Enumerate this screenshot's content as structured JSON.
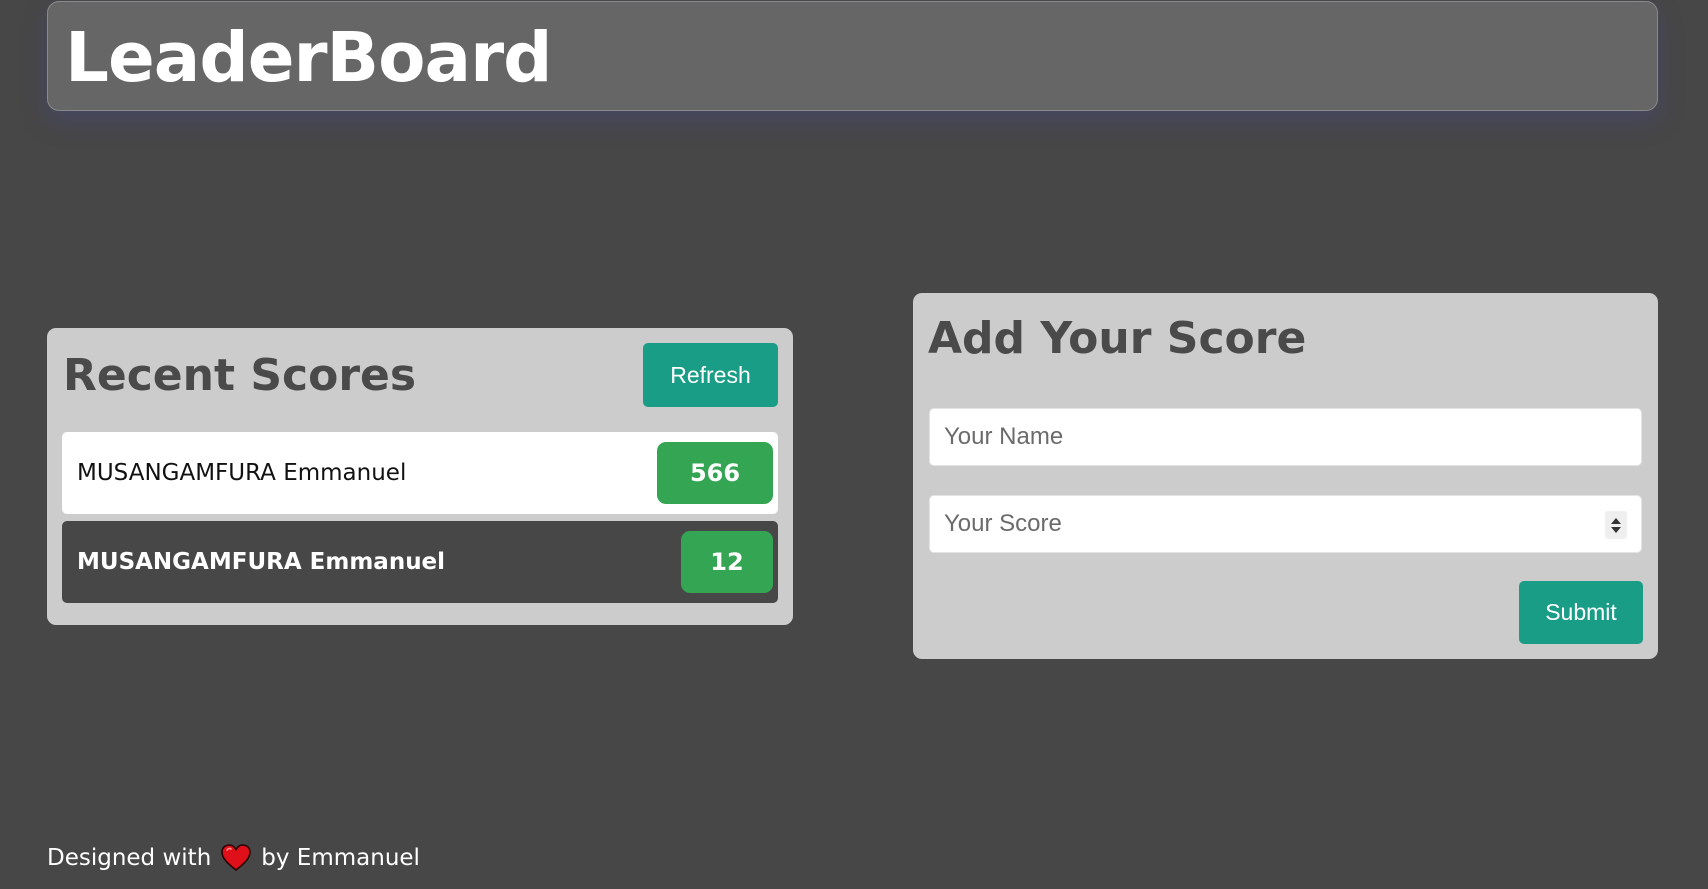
{
  "header": {
    "title": "LeaderBoard"
  },
  "recent": {
    "title": "Recent Scores",
    "refresh_label": "Refresh",
    "scores": [
      {
        "name": "MUSANGAMFURA Emmanuel",
        "score": "566"
      },
      {
        "name": "MUSANGAMFURA Emmanuel",
        "score": "12"
      }
    ]
  },
  "add_score": {
    "title": "Add Your Score",
    "name_placeholder": "Your Name",
    "name_value": "",
    "score_placeholder": "Your Score",
    "score_value": "",
    "submit_label": "Submit"
  },
  "footer": {
    "prefix": "Designed with",
    "heart_icon": "heart-icon",
    "suffix": "by Emmanuel"
  },
  "colors": {
    "background": "#474747",
    "header_bg": "#666666",
    "panel_bg": "#cccccc",
    "button_teal": "#1a9d86",
    "badge_green": "#34a553",
    "heart_red": "#e0101a"
  }
}
